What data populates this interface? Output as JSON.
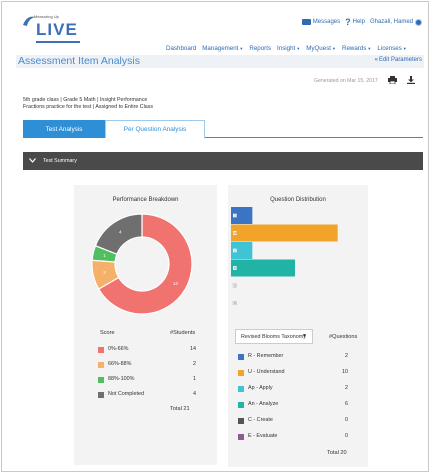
{
  "header": {
    "logo_small": "Measuring Up",
    "logo_main": "LIVE",
    "messages": "Messages",
    "help": "Help",
    "user": "Ghazali, Hamed"
  },
  "nav": [
    {
      "label": "Dashboard",
      "caret": false
    },
    {
      "label": "Management",
      "caret": true
    },
    {
      "label": "Reports",
      "caret": false
    },
    {
      "label": "Insight",
      "caret": true
    },
    {
      "label": "MyQuest",
      "caret": true
    },
    {
      "label": "Rewards",
      "caret": true
    },
    {
      "label": "Licenses",
      "caret": true
    }
  ],
  "page": {
    "title": "Assessment Item Analysis",
    "edit_params": "Edit Parameters",
    "generated": "Generated on Mar 15, 2017",
    "meta_line1": "5th grade class  |  Grade 5 Math  |  Insight Performance",
    "meta_line2": "Fractions practice for the test  |  Assigned to Entire Class"
  },
  "tabs": {
    "active": "Test Analysis",
    "inactive": "Per Question Analysis"
  },
  "summary": {
    "title": "Test Summary"
  },
  "performance": {
    "title": "Performance Breakdown",
    "col_score": "Score",
    "col_students": "#Students",
    "rows": [
      {
        "label": "0%-66%",
        "value": "14",
        "color": "#f0736f"
      },
      {
        "label": "66%-88%",
        "value": "2",
        "color": "#f5b06a"
      },
      {
        "label": "88%-100%",
        "value": "1",
        "color": "#4fbf5f"
      },
      {
        "label": "Not Completed",
        "value": "4",
        "color": "#6f6f6f"
      }
    ],
    "total": "Total 21",
    "slice_labels": [
      "14",
      "2",
      "1",
      "4"
    ]
  },
  "questions": {
    "title": "Question Distribution",
    "select_label": "Revised Blooms Taxonomy",
    "col_questions": "#Questions",
    "rows": [
      {
        "label": "R - Remember",
        "value": "2",
        "color": "#3b74c4"
      },
      {
        "label": "U - Understand",
        "value": "10",
        "color": "#f2a42a"
      },
      {
        "label": "Ap - Apply",
        "value": "2",
        "color": "#3fc4d6"
      },
      {
        "label": "An - Analyze",
        "value": "6",
        "color": "#21b3a6"
      },
      {
        "label": "C - Create",
        "value": "0",
        "color": "#555555"
      },
      {
        "label": "E - Evaluate",
        "value": "0",
        "color": "#8a5c90"
      }
    ],
    "bar_labels": [
      "2",
      "10",
      "2",
      "6",
      "0",
      "0"
    ],
    "total": "Total 20"
  },
  "chart_data": [
    {
      "type": "pie",
      "title": "Performance Breakdown",
      "categories": [
        "0%-66%",
        "66%-88%",
        "88%-100%",
        "Not Completed"
      ],
      "values": [
        14,
        2,
        1,
        4
      ]
    },
    {
      "type": "bar",
      "title": "Question Distribution",
      "categories": [
        "R - Remember",
        "U - Understand",
        "Ap - Apply",
        "An - Analyze",
        "C - Create",
        "E - Evaluate"
      ],
      "values": [
        2,
        10,
        2,
        6,
        0,
        0
      ]
    }
  ],
  "colors": {
    "accent": "#2f8fd6",
    "link": "#2f6bb3",
    "summary_bar": "#4a4a4a"
  }
}
